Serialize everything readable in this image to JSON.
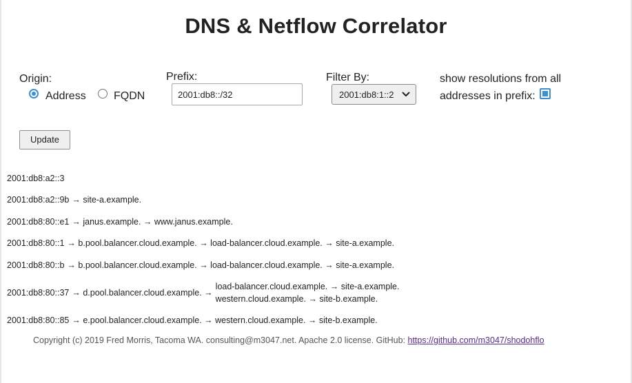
{
  "page": {
    "title": "DNS & Netflow Correlator"
  },
  "form": {
    "origin_label": "Origin:",
    "origin_options": [
      {
        "label": "Address",
        "checked": true
      },
      {
        "label": "FQDN",
        "checked": false
      }
    ],
    "prefix_label": "Prefix:",
    "prefix_value": "2001:db8::/32",
    "filter_label": "Filter By:",
    "filter_selected": "2001:db8:1::2",
    "show_all_line1": "show resolutions from all",
    "show_all_line2": "addresses in prefix:",
    "show_all_checked": true,
    "update_label": "Update"
  },
  "results": [
    {
      "address": "2001:db8:a2::3",
      "chain": ""
    },
    {
      "address": "2001:db8:a2::9b",
      "chain": "→ site-a.example."
    },
    {
      "address": "2001:db8:80::e1",
      "chain": "→ janus.example. → www.janus.example."
    },
    {
      "address": "2001:db8:80::1",
      "chain": "→ b.pool.balancer.cloud.example. → load-balancer.cloud.example. → site-a.example."
    },
    {
      "address": "2001:db8:80::b",
      "chain": "→ b.pool.balancer.cloud.example. → load-balancer.cloud.example. → site-a.example."
    },
    {
      "address": "2001:db8:80::37",
      "chain": "→ d.pool.balancer.cloud.example. →",
      "branches": [
        "load-balancer.cloud.example. → site-a.example.",
        "western.cloud.example. → site-b.example."
      ]
    },
    {
      "address": "2001:db8:80::85",
      "chain": "→ e.pool.balancer.cloud.example. → western.cloud.example. → site-b.example."
    }
  ],
  "footer": {
    "text": "Copyright (c) 2019 Fred Morris, Tacoma WA. consulting@m3047.net. Apache 2.0 license. GitHub: ",
    "link_text": "https://github.com/m3047/shodohflo"
  },
  "colors": {
    "accent": "#3b8fd6",
    "link": "#5a2b8a"
  },
  "icons": {
    "select_arrow": "chevron-down-icon"
  }
}
